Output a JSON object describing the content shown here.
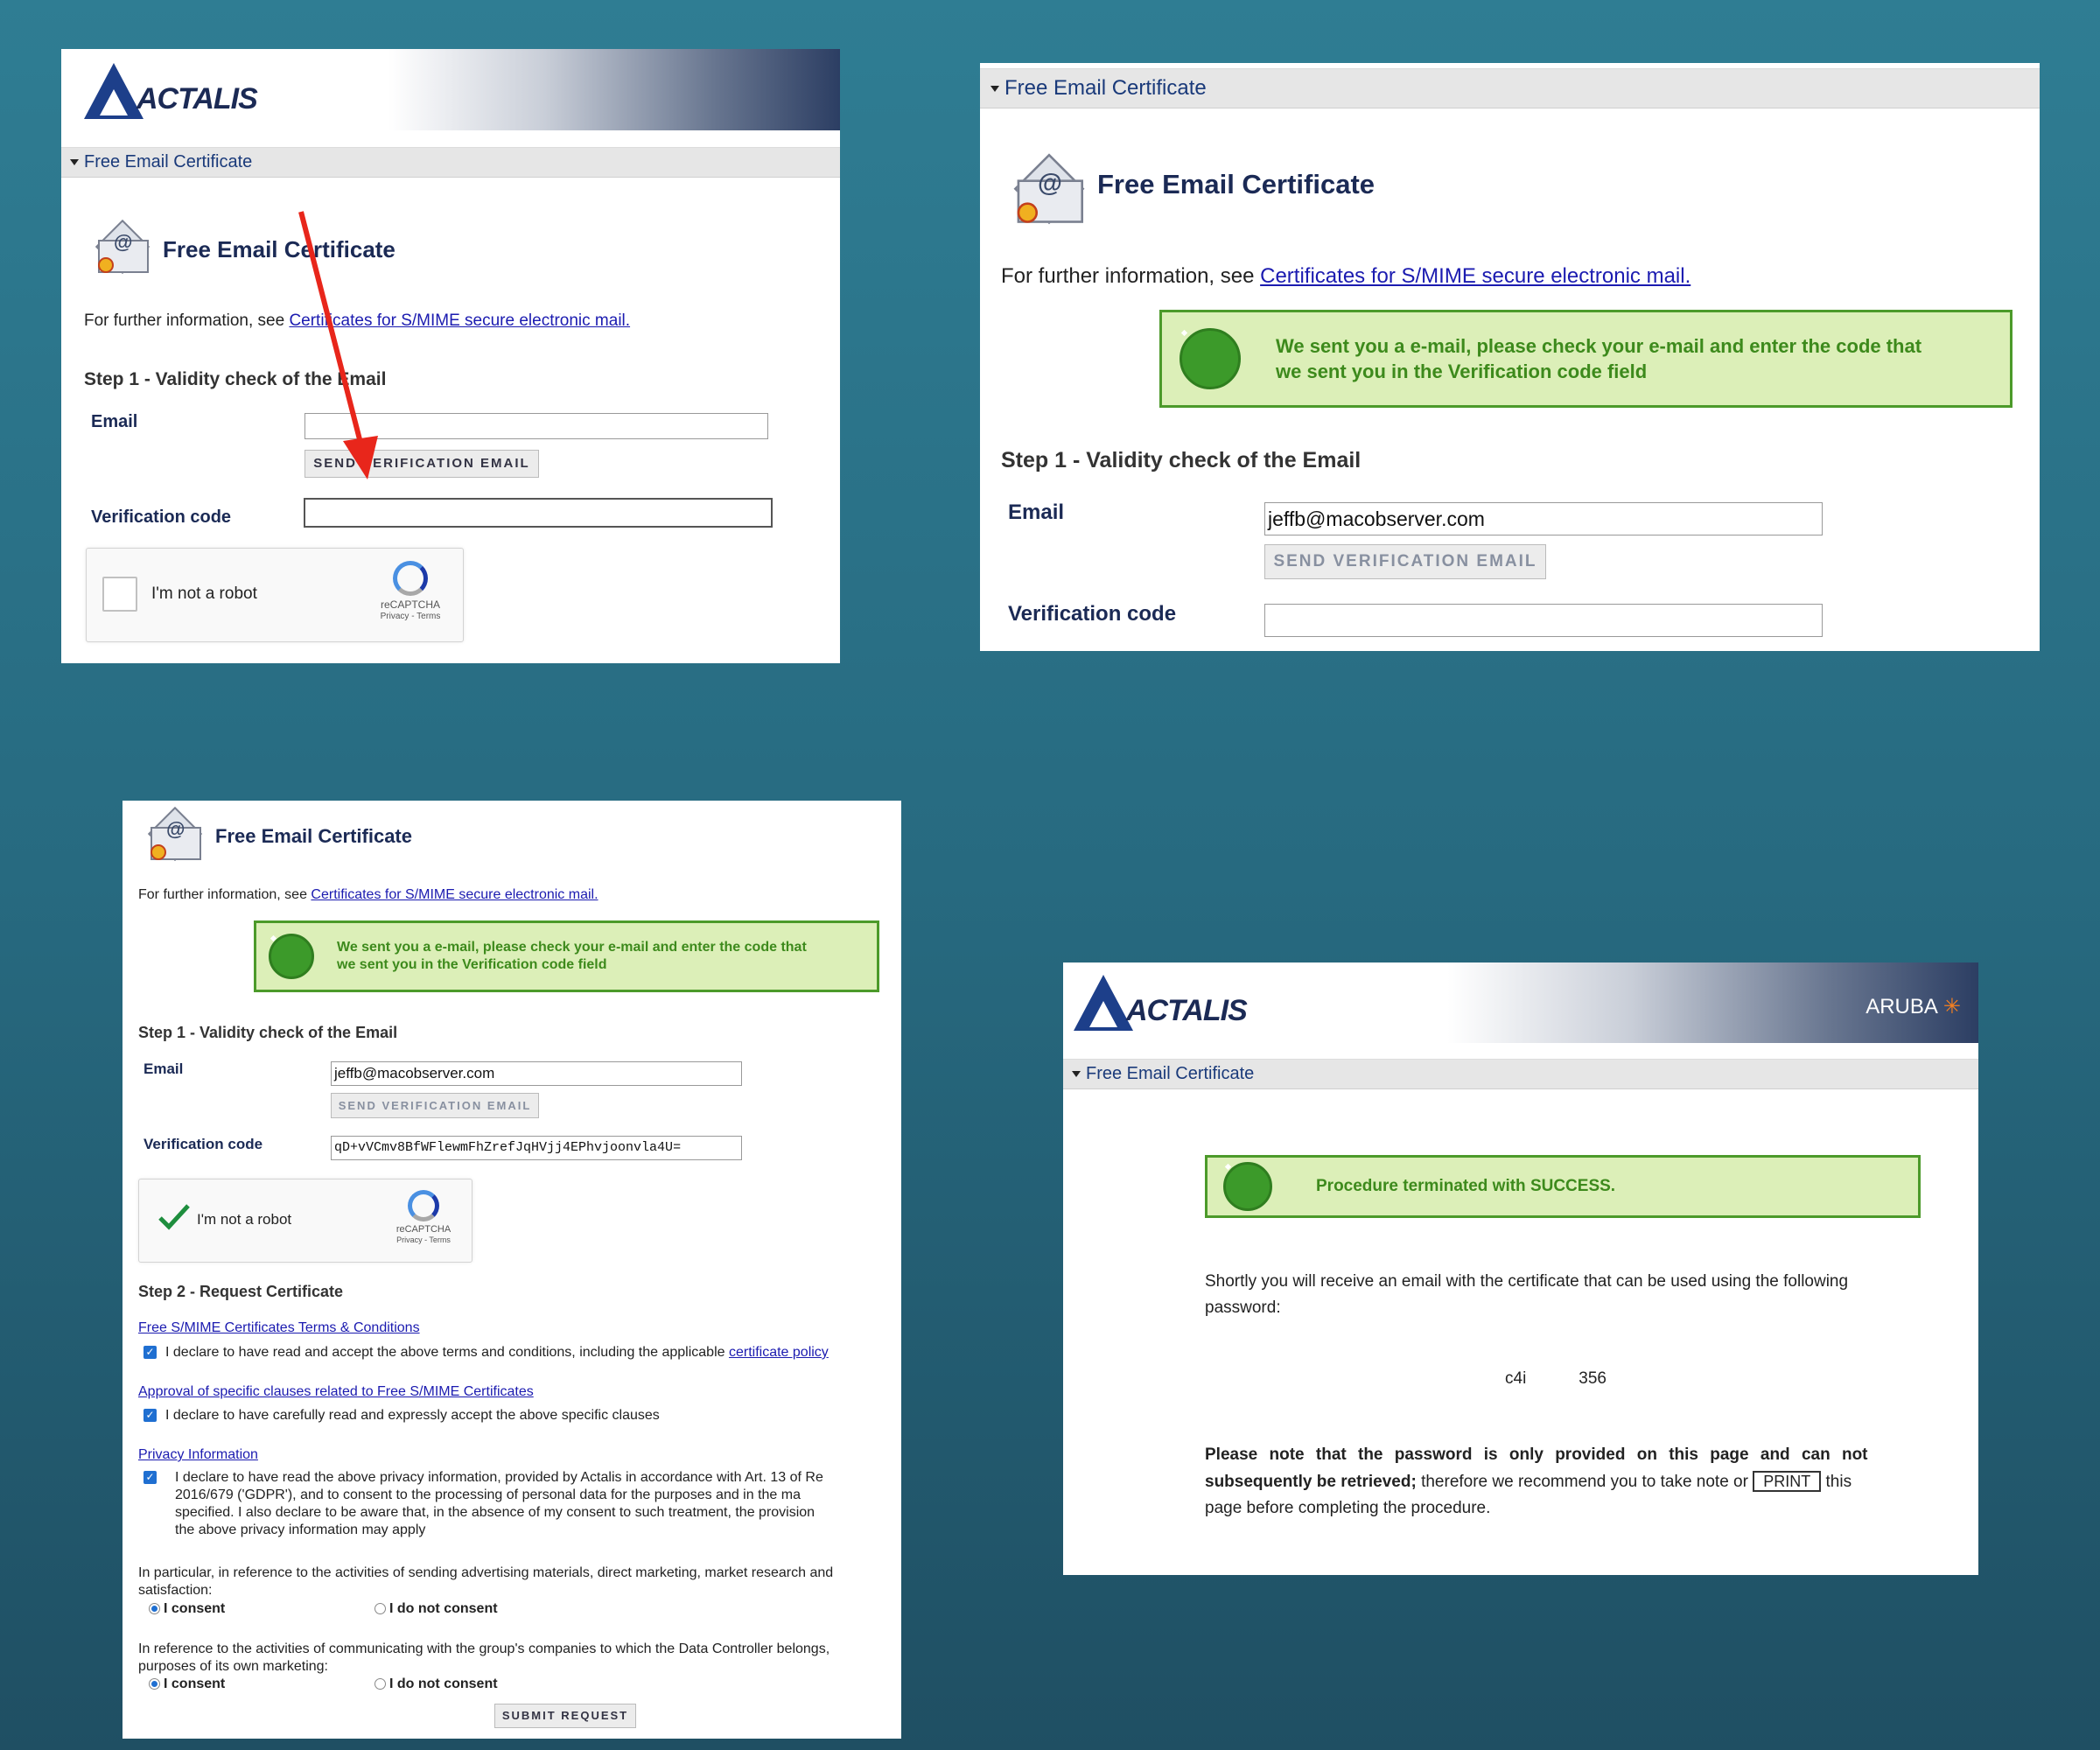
{
  "brand": {
    "logo_text": "ACTALIS",
    "aruba_text": "ARUBA",
    "aruba_star": "✳"
  },
  "section_label": "Free Email Certificate",
  "page_title": "Free Email Certificate",
  "info": {
    "prefix": "For further information, see ",
    "link": "Certificates for S/MIME secure electronic mail."
  },
  "alert": {
    "message_line1": "We sent you a e-mail, please check your e-mail and enter the code that",
    "message_line2": "we sent you in the Verification code field"
  },
  "step1": {
    "title": "Step 1 - Validity check of the Email",
    "email_label": "Email",
    "send_button": "SEND VERIFICATION EMAIL",
    "code_label": "Verification code"
  },
  "email_value": "jeffb@macobserver.com",
  "code_value": "qD+vVCmv8BfWFlewmFhZrefJqHVjj4EPhvjoonvla4U=",
  "captcha": {
    "label": "I'm not a robot",
    "brand": "reCAPTCHA",
    "links": "Privacy - Terms"
  },
  "step2": {
    "title": "Step 2 - Request Certificate",
    "terms_link": "Free S/MIME Certificates Terms & Conditions",
    "terms_check_prefix": "I declare to have read and accept the above terms and conditions, including the applicable ",
    "terms_check_link": "certificate policy",
    "clauses_link": "Approval of specific clauses related to Free S/MIME Certificates",
    "clauses_check": "I declare to have carefully read and expressly accept the above specific clauses",
    "privacy_link": "Privacy Information",
    "privacy_line1": "I declare to have read the above privacy information, provided by Actalis in accordance with Art. 13 of Re",
    "privacy_line2": "2016/679 ('GDPR'), and to consent to the processing of personal data for the purposes and in the ma",
    "privacy_line3": "specified. I also declare to be aware that, in the absence of my consent to such treatment, the provision",
    "privacy_line4": "the above privacy information may apply",
    "marketing_line1": "In particular, in reference to the activities of sending advertising materials, direct marketing, market research and",
    "marketing_line2": "satisfaction:",
    "group_line1": "In reference to the activities of communicating with the group's companies to which the Data Controller belongs,",
    "group_line2": "purposes of its own marketing:",
    "consent": "I consent",
    "no_consent": "I do not consent",
    "submit": "SUBMIT REQUEST"
  },
  "success": {
    "message": "Procedure terminated with SUCCESS.",
    "shortly_line1": "Shortly you will receive an email with the certificate that can be used using the following",
    "shortly_line2": "password:",
    "pw_start": "c4i",
    "pw_end": "356",
    "note_bold1": "Please note that the password is only provided on this page and can not",
    "note_bold2": "subsequently be retrieved;",
    "note_rest": " therefore we recommend you to take note or ",
    "print_button": "PRINT",
    "note_after": " this",
    "note_line3": "page before completing the procedure."
  },
  "colors": {
    "annotation_arrow": "#e8261b",
    "alert_green": "#3d8a1c",
    "link_blue": "#1b1bb0"
  }
}
